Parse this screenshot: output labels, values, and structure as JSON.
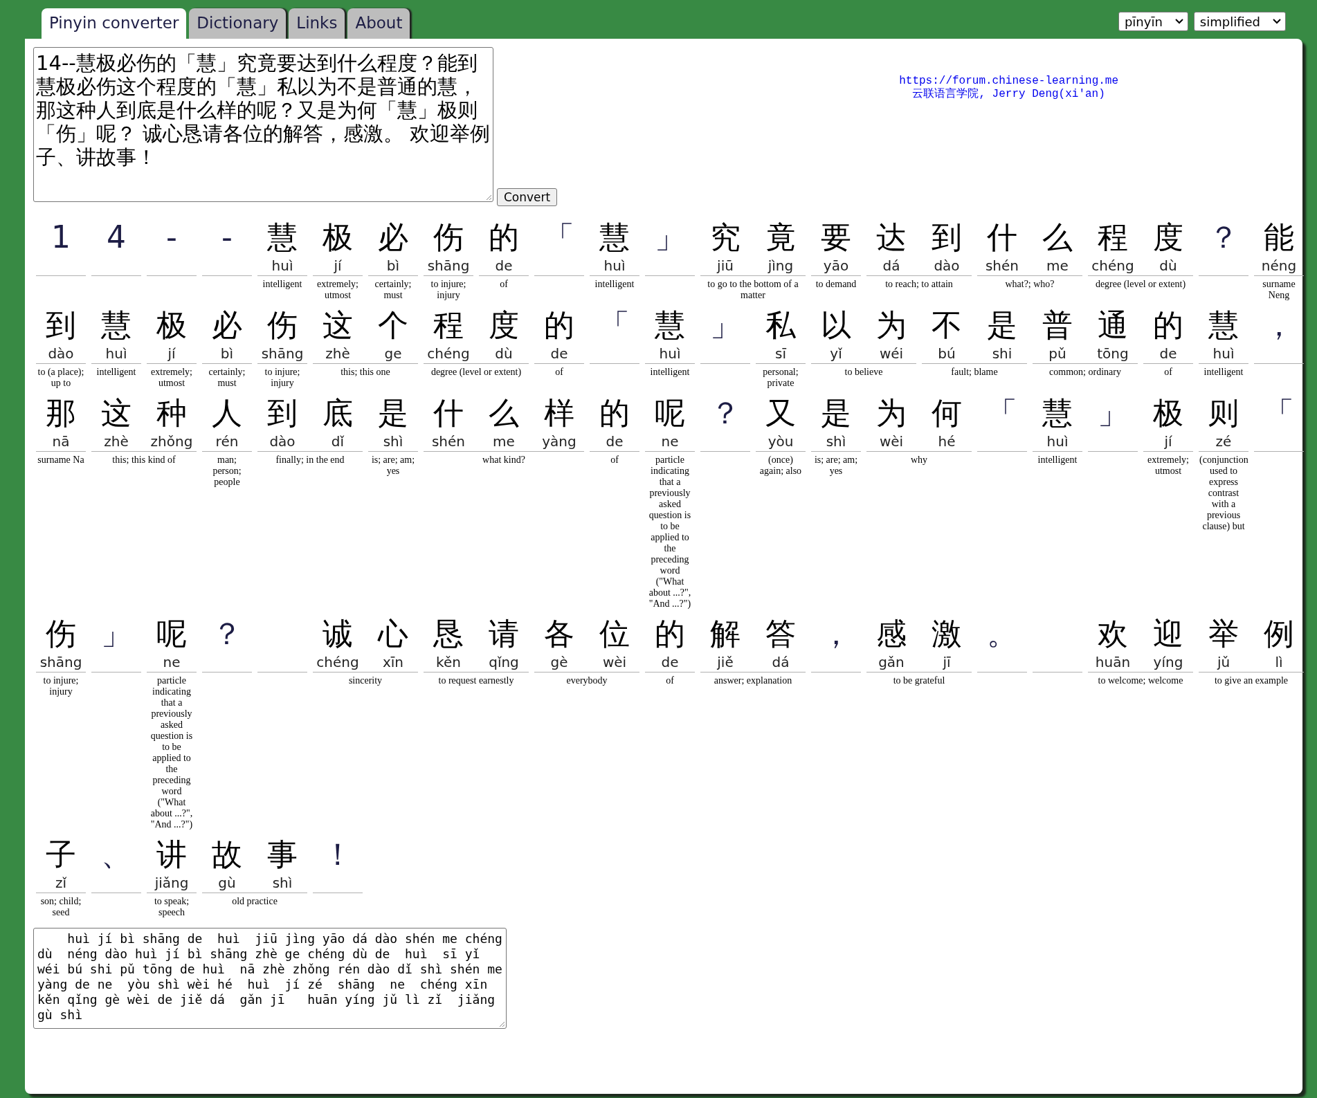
{
  "tabs": [
    {
      "label": "Pinyin converter",
      "selected": true
    },
    {
      "label": "Dictionary",
      "selected": false
    },
    {
      "label": "Links",
      "selected": false
    },
    {
      "label": "About",
      "selected": false
    }
  ],
  "selects": [
    {
      "value": "pīnyīn"
    },
    {
      "value": "simplified"
    }
  ],
  "input": {
    "value": "14--慧极必伤的「慧」究竟要达到什么程度？能到慧极必伤这个程度的「慧」私以为不是普通的慧，那这种人到底是什么样的呢？又是为何「慧」极则「伤」呢？ 诚心恳请各位的解答，感激。 欢迎举例子、讲故事！"
  },
  "convert_button": "Convert",
  "credit": {
    "link": "https://forum.chinese-learning.me",
    "text": "云联语言学院, Jerry Deng(xi'an)"
  },
  "words": [
    {
      "kind": "word",
      "chars": [
        {
          "hanzi": "1"
        }
      ]
    },
    {
      "kind": "word",
      "chars": [
        {
          "hanzi": "4"
        }
      ]
    },
    {
      "kind": "word",
      "chars": [
        {
          "hanzi": "-"
        }
      ]
    },
    {
      "kind": "word",
      "chars": [
        {
          "hanzi": "-"
        }
      ]
    },
    {
      "kind": "word",
      "chars": [
        {
          "hanzi": "慧",
          "pinyin": "huì"
        }
      ],
      "definition": "intelligent"
    },
    {
      "kind": "word",
      "chars": [
        {
          "hanzi": "极",
          "pinyin": "jí"
        }
      ],
      "definition": "extremely; utmost"
    },
    {
      "kind": "word",
      "chars": [
        {
          "hanzi": "必",
          "pinyin": "bì"
        }
      ],
      "definition": "certainly; must"
    },
    {
      "kind": "word",
      "chars": [
        {
          "hanzi": "伤",
          "pinyin": "shāng"
        }
      ],
      "definition": "to injure; injury"
    },
    {
      "kind": "word",
      "chars": [
        {
          "hanzi": "的",
          "pinyin": "de"
        }
      ],
      "definition": "of"
    },
    {
      "kind": "word",
      "chars": [
        {
          "hanzi": "「"
        }
      ]
    },
    {
      "kind": "word",
      "chars": [
        {
          "hanzi": "慧",
          "pinyin": "huì"
        }
      ],
      "definition": "intelligent"
    },
    {
      "kind": "word",
      "chars": [
        {
          "hanzi": "」"
        }
      ]
    },
    {
      "kind": "word",
      "chars": [
        {
          "hanzi": "究",
          "pinyin": "jiū"
        },
        {
          "hanzi": "竟",
          "pinyin": "jìng"
        }
      ],
      "definition": "to go to the bottom of a matter"
    },
    {
      "kind": "word",
      "chars": [
        {
          "hanzi": "要",
          "pinyin": "yāo"
        }
      ],
      "definition": "to demand"
    },
    {
      "kind": "word",
      "chars": [
        {
          "hanzi": "达",
          "pinyin": "dá"
        },
        {
          "hanzi": "到",
          "pinyin": "dào"
        }
      ],
      "definition": "to reach; to attain"
    },
    {
      "kind": "word",
      "chars": [
        {
          "hanzi": "什",
          "pinyin": "shén"
        },
        {
          "hanzi": "么",
          "pinyin": "me"
        }
      ],
      "definition": "what?; who?"
    },
    {
      "kind": "word",
      "chars": [
        {
          "hanzi": "程",
          "pinyin": "chéng"
        },
        {
          "hanzi": "度",
          "pinyin": "dù"
        }
      ],
      "definition": "degree (level or extent)"
    },
    {
      "kind": "word",
      "chars": [
        {
          "hanzi": "？"
        }
      ]
    },
    {
      "kind": "word",
      "chars": [
        {
          "hanzi": "能",
          "pinyin": "néng"
        }
      ],
      "definition": "surname Neng"
    },
    {
      "kind": "word",
      "chars": [
        {
          "hanzi": "到",
          "pinyin": "dào"
        }
      ],
      "definition": "to (a place); up to"
    },
    {
      "kind": "word",
      "chars": [
        {
          "hanzi": "慧",
          "pinyin": "huì"
        }
      ],
      "definition": "intelligent"
    },
    {
      "kind": "word",
      "chars": [
        {
          "hanzi": "极",
          "pinyin": "jí"
        }
      ],
      "definition": "extremely; utmost"
    },
    {
      "kind": "word",
      "chars": [
        {
          "hanzi": "必",
          "pinyin": "bì"
        }
      ],
      "definition": "certainly; must"
    },
    {
      "kind": "word",
      "chars": [
        {
          "hanzi": "伤",
          "pinyin": "shāng"
        }
      ],
      "definition": "to injure; injury"
    },
    {
      "kind": "word",
      "chars": [
        {
          "hanzi": "这",
          "pinyin": "zhè"
        },
        {
          "hanzi": "个",
          "pinyin": "ge"
        }
      ],
      "definition": "this; this one"
    },
    {
      "kind": "word",
      "chars": [
        {
          "hanzi": "程",
          "pinyin": "chéng"
        },
        {
          "hanzi": "度",
          "pinyin": "dù"
        }
      ],
      "definition": "degree (level or extent)"
    },
    {
      "kind": "word",
      "chars": [
        {
          "hanzi": "的",
          "pinyin": "de"
        }
      ],
      "definition": "of"
    },
    {
      "kind": "word",
      "chars": [
        {
          "hanzi": "「"
        }
      ]
    },
    {
      "kind": "word",
      "chars": [
        {
          "hanzi": "慧",
          "pinyin": "huì"
        }
      ],
      "definition": "intelligent"
    },
    {
      "kind": "word",
      "chars": [
        {
          "hanzi": "」"
        }
      ]
    },
    {
      "kind": "word",
      "chars": [
        {
          "hanzi": "私",
          "pinyin": "sī"
        }
      ],
      "definition": "personal; private"
    },
    {
      "kind": "word",
      "chars": [
        {
          "hanzi": "以",
          "pinyin": "yǐ"
        },
        {
          "hanzi": "为",
          "pinyin": "wéi"
        }
      ],
      "definition": "to believe"
    },
    {
      "kind": "word",
      "chars": [
        {
          "hanzi": "不",
          "pinyin": "bú"
        },
        {
          "hanzi": "是",
          "pinyin": "shi"
        }
      ],
      "definition": "fault; blame"
    },
    {
      "kind": "word",
      "chars": [
        {
          "hanzi": "普",
          "pinyin": "pǔ"
        },
        {
          "hanzi": "通",
          "pinyin": "tōng"
        }
      ],
      "definition": "common; ordinary"
    },
    {
      "kind": "word",
      "chars": [
        {
          "hanzi": "的",
          "pinyin": "de"
        }
      ],
      "definition": "of"
    },
    {
      "kind": "word",
      "chars": [
        {
          "hanzi": "慧",
          "pinyin": "huì"
        }
      ],
      "definition": "intelligent"
    },
    {
      "kind": "word",
      "chars": [
        {
          "hanzi": "，"
        }
      ]
    },
    {
      "kind": "word",
      "chars": [
        {
          "hanzi": "那",
          "pinyin": "nā"
        }
      ],
      "definition": "surname Na"
    },
    {
      "kind": "word",
      "chars": [
        {
          "hanzi": "这",
          "pinyin": "zhè"
        },
        {
          "hanzi": "种",
          "pinyin": "zhǒng"
        }
      ],
      "definition": "this; this kind of"
    },
    {
      "kind": "word",
      "chars": [
        {
          "hanzi": "人",
          "pinyin": "rén"
        }
      ],
      "definition": "man; person; people"
    },
    {
      "kind": "word",
      "chars": [
        {
          "hanzi": "到",
          "pinyin": "dào"
        },
        {
          "hanzi": "底",
          "pinyin": "dǐ"
        }
      ],
      "definition": "finally; in the end"
    },
    {
      "kind": "word",
      "chars": [
        {
          "hanzi": "是",
          "pinyin": "shì"
        }
      ],
      "definition": "is; are; am; yes"
    },
    {
      "kind": "word",
      "chars": [
        {
          "hanzi": "什",
          "pinyin": "shén"
        },
        {
          "hanzi": "么",
          "pinyin": "me"
        },
        {
          "hanzi": "样",
          "pinyin": "yàng"
        }
      ],
      "definition": "what kind?"
    },
    {
      "kind": "word",
      "chars": [
        {
          "hanzi": "的",
          "pinyin": "de"
        }
      ],
      "definition": "of"
    },
    {
      "kind": "word",
      "chars": [
        {
          "hanzi": "呢",
          "pinyin": "ne"
        }
      ],
      "definition": "particle indicating that a previously asked question is to be applied to the preceding word (\"What about ...?\", \"And ...?\")"
    },
    {
      "kind": "word",
      "chars": [
        {
          "hanzi": "？"
        }
      ]
    },
    {
      "kind": "word",
      "chars": [
        {
          "hanzi": "又",
          "pinyin": "yòu"
        }
      ],
      "definition": "(once) again; also"
    },
    {
      "kind": "word",
      "chars": [
        {
          "hanzi": "是",
          "pinyin": "shì"
        }
      ],
      "definition": "is; are; am; yes"
    },
    {
      "kind": "word",
      "chars": [
        {
          "hanzi": "为",
          "pinyin": "wèi"
        },
        {
          "hanzi": "何",
          "pinyin": "hé"
        }
      ],
      "definition": "why"
    },
    {
      "kind": "word",
      "chars": [
        {
          "hanzi": "「"
        }
      ]
    },
    {
      "kind": "word",
      "chars": [
        {
          "hanzi": "慧",
          "pinyin": "huì"
        }
      ],
      "definition": "intelligent"
    },
    {
      "kind": "word",
      "chars": [
        {
          "hanzi": "」"
        }
      ]
    },
    {
      "kind": "word",
      "chars": [
        {
          "hanzi": "极",
          "pinyin": "jí"
        }
      ],
      "definition": "extremely; utmost"
    },
    {
      "kind": "word",
      "chars": [
        {
          "hanzi": "则",
          "pinyin": "zé"
        }
      ],
      "definition": "(conjunction used to express contrast with a previous clause) but"
    },
    {
      "kind": "word",
      "chars": [
        {
          "hanzi": "「"
        }
      ]
    },
    {
      "kind": "word",
      "chars": [
        {
          "hanzi": "伤",
          "pinyin": "shāng"
        }
      ],
      "definition": "to injure; injury"
    },
    {
      "kind": "word",
      "chars": [
        {
          "hanzi": "」"
        }
      ]
    },
    {
      "kind": "word",
      "chars": [
        {
          "hanzi": "呢",
          "pinyin": "ne"
        }
      ],
      "definition": "particle indicating that a previously asked question is to be applied to the preceding word (\"What about ...?\", \"And ...?\")"
    },
    {
      "kind": "word",
      "chars": [
        {
          "hanzi": "？"
        }
      ]
    },
    {
      "kind": "blank"
    },
    {
      "kind": "word",
      "chars": [
        {
          "hanzi": "诚",
          "pinyin": "chéng"
        },
        {
          "hanzi": "心",
          "pinyin": "xīn"
        }
      ],
      "definition": "sincerity"
    },
    {
      "kind": "word",
      "chars": [
        {
          "hanzi": "恳",
          "pinyin": "kěn"
        },
        {
          "hanzi": "请",
          "pinyin": "qǐng"
        }
      ],
      "definition": "to request earnestly"
    },
    {
      "kind": "word",
      "chars": [
        {
          "hanzi": "各",
          "pinyin": "gè"
        },
        {
          "hanzi": "位",
          "pinyin": "wèi"
        }
      ],
      "definition": "everybody"
    },
    {
      "kind": "word",
      "chars": [
        {
          "hanzi": "的",
          "pinyin": "de"
        }
      ],
      "definition": "of"
    },
    {
      "kind": "word",
      "chars": [
        {
          "hanzi": "解",
          "pinyin": "jiě"
        },
        {
          "hanzi": "答",
          "pinyin": "dá"
        }
      ],
      "definition": "answer; explanation"
    },
    {
      "kind": "word",
      "chars": [
        {
          "hanzi": "，"
        }
      ]
    },
    {
      "kind": "word",
      "chars": [
        {
          "hanzi": "感",
          "pinyin": "gǎn"
        },
        {
          "hanzi": "激",
          "pinyin": "jī"
        }
      ],
      "definition": "to be grateful"
    },
    {
      "kind": "word",
      "chars": [
        {
          "hanzi": "。"
        }
      ]
    },
    {
      "kind": "blank"
    },
    {
      "kind": "word",
      "chars": [
        {
          "hanzi": "欢",
          "pinyin": "huān"
        },
        {
          "hanzi": "迎",
          "pinyin": "yíng"
        }
      ],
      "definition": "to welcome; welcome"
    },
    {
      "kind": "word",
      "chars": [
        {
          "hanzi": "举",
          "pinyin": "jǔ"
        },
        {
          "hanzi": "例",
          "pinyin": "lì"
        }
      ],
      "definition": "to give an example"
    },
    {
      "kind": "word",
      "chars": [
        {
          "hanzi": "子",
          "pinyin": "zǐ"
        }
      ],
      "definition": "son; child; seed"
    },
    {
      "kind": "word",
      "chars": [
        {
          "hanzi": "、"
        }
      ]
    },
    {
      "kind": "word",
      "chars": [
        {
          "hanzi": "讲",
          "pinyin": "jiǎng"
        }
      ],
      "definition": "to speak; speech"
    },
    {
      "kind": "word",
      "chars": [
        {
          "hanzi": "故",
          "pinyin": "gù"
        },
        {
          "hanzi": "事",
          "pinyin": "shì"
        }
      ],
      "definition": "old practice"
    },
    {
      "kind": "word",
      "chars": [
        {
          "hanzi": "！"
        }
      ]
    }
  ],
  "output": {
    "value": "    huì jí bì shāng de  huì  jiū jìng yāo dá dào shén me chéng dù  néng dào huì jí bì shāng zhè ge chéng dù de  huì  sī yǐ wéi bú shi pǔ tōng de huì  nā zhè zhǒng rén dào dǐ shì shén me yàng de ne  yòu shì wèi hé  huì  jí zé  shāng  ne  chéng xīn kěn qǐng gè wèi de jiě dá  gǎn jī   huān yíng jǔ lì zǐ  jiǎng gù shì"
  }
}
